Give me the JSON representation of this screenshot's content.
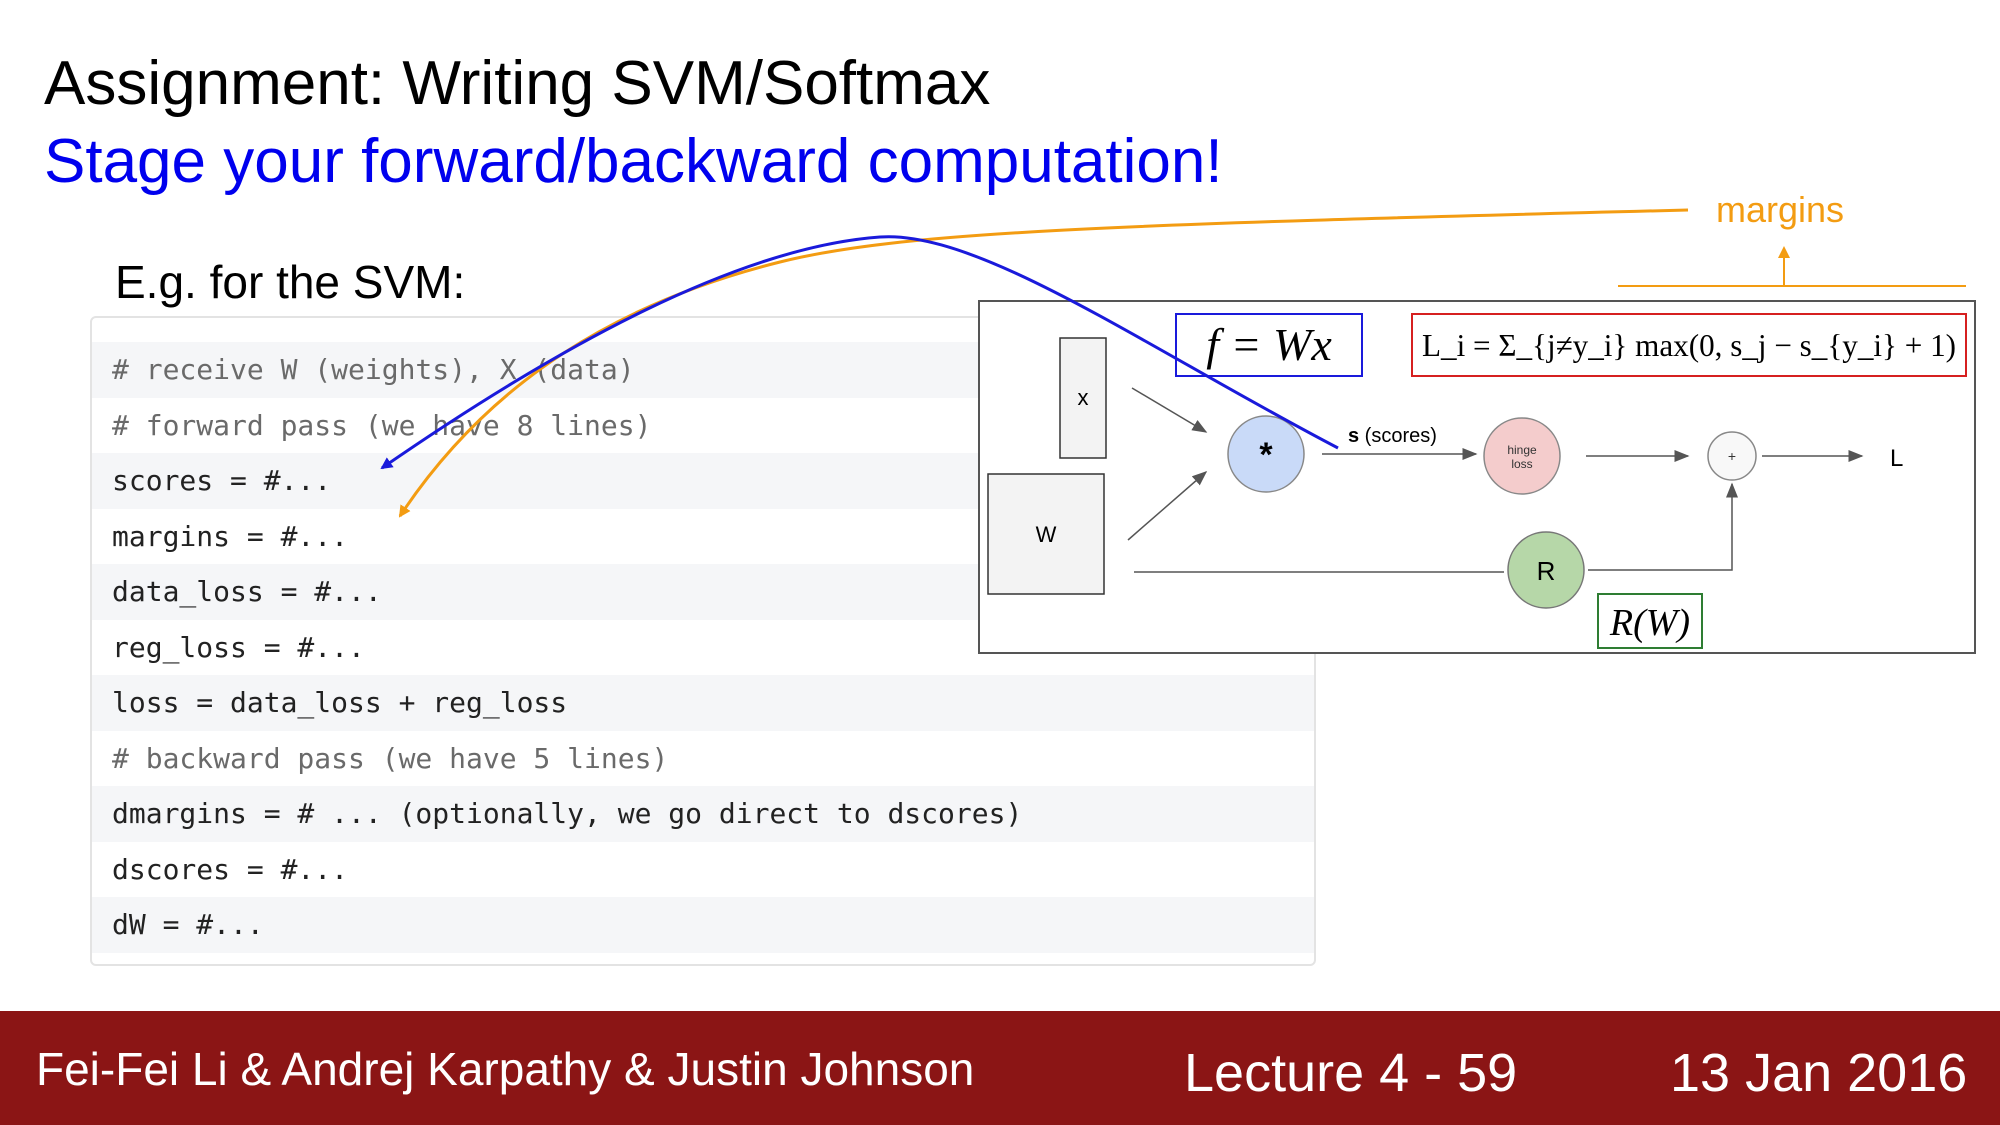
{
  "slide": {
    "title": "Assignment: Writing SVM/Softmax",
    "subtitle": "Stage your forward/backward computation!",
    "example_label": "E.g. for the SVM:"
  },
  "code_lines": [
    "# receive W (weights), X (data)",
    "# forward pass (we have 8 lines)",
    "scores = #...",
    "margins = #...",
    "data_loss = #...",
    "reg_loss = #...",
    "loss = data_loss + reg_loss",
    "# backward pass (we have 5 lines)",
    "dmargins = # ... (optionally, we go direct to dscores)",
    "dscores = #...",
    "dW = #..."
  ],
  "diagram": {
    "node_x": "x",
    "node_w": "W",
    "node_mult": "*",
    "scores_bold": "s",
    "scores_rest": " (scores)",
    "node_hinge_1": "hinge",
    "node_hinge_2": "loss",
    "node_plus": "+",
    "node_r": "R",
    "output_l": "L",
    "formula_f": "f = Wx",
    "formula_li": "L_i = Σ_{j≠y_i} max(0, s_j − s_{y_i} + 1)",
    "formula_rw": "R(W)"
  },
  "annotation": {
    "margins_label": "margins"
  },
  "colors": {
    "subtitle": "#0000ee",
    "arrow_blue": "#1a1adb",
    "arrow_orange": "#f39c12",
    "footer_bg": "#8b1515",
    "mult_node": "#c9daf8",
    "hinge_node": "#f4cccc",
    "r_node": "#b6d7a8"
  },
  "footer": {
    "authors": "Fei-Fei Li & Andrej Karpathy & Justin Johnson",
    "lecture": "Lecture 4 - 59",
    "date": "13 Jan 2016"
  }
}
